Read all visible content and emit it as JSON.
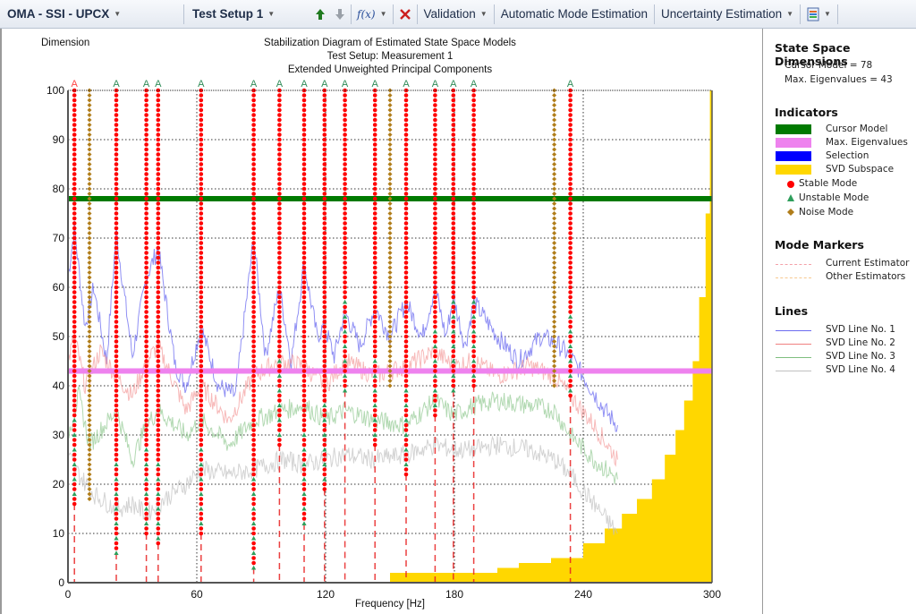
{
  "toolbar": {
    "analysis_label": "OMA - SSI - UPCX",
    "setup_label": "Test Setup 1",
    "up_arrow_icon": "green-up-arrow",
    "down_arrow_icon": "gray-down-arrow",
    "function_icon": "f(x)",
    "delete_icon": "red-x",
    "validation_label": "Validation",
    "auto_mode_label": "Automatic Mode Estimation",
    "uncertainty_label": "Uncertainty Estimation",
    "display_icon": "display-options"
  },
  "side_panel": {
    "dimensions_title": "State Space Dimensions",
    "cursor_model_text": "Cursor Model = 78",
    "max_eigen_text": "Max. Eigenvalues = 43",
    "indicators_title": "Indicators",
    "indicators": [
      {
        "label": "Cursor Model",
        "color": "#007a00",
        "kind": "bar"
      },
      {
        "label": "Max. Eigenvalues",
        "color": "#ee82ee",
        "kind": "bar"
      },
      {
        "label": "Selection",
        "color": "#0000ff",
        "kind": "bar"
      },
      {
        "label": "SVD Subspace",
        "color": "#ffd700",
        "kind": "bar"
      },
      {
        "label": "Stable Mode",
        "color": "#ff0000",
        "kind": "circle"
      },
      {
        "label": "Unstable Mode",
        "color": "#2e9e5b",
        "kind": "triangle"
      },
      {
        "label": "Noise Mode",
        "color": "#b07d1a",
        "kind": "diamond"
      }
    ],
    "markers_title": "Mode Markers",
    "markers": [
      {
        "label": "Current Estimator",
        "color": "#f4a0a8"
      },
      {
        "label": "Other Estimators",
        "color": "#f7c890"
      }
    ],
    "lines_title": "Lines",
    "lines": [
      {
        "label": "SVD Line No. 1",
        "color": "#6b6bf0"
      },
      {
        "label": "SVD Line No. 2",
        "color": "#f08080"
      },
      {
        "label": "SVD Line No. 3",
        "color": "#7fbf7f"
      },
      {
        "label": "SVD Line No. 4",
        "color": "#c0c0c0"
      }
    ]
  },
  "chart_data": {
    "type": "scatter",
    "title": "Stabilization Diagram of Estimated State Space Models",
    "subtitle_1": "Test Setup: Measurement 1",
    "subtitle_2": "Extended Unweighted Principal Components",
    "xlabel": "Frequency [Hz]",
    "ylabel": "Dimension",
    "xlim": [
      0,
      300
    ],
    "ylim": [
      0,
      100
    ],
    "xticks": [
      0,
      60,
      120,
      180,
      240,
      300
    ],
    "yticks": [
      0,
      10,
      20,
      30,
      40,
      50,
      60,
      70,
      80,
      90,
      100
    ],
    "grid": true,
    "cursor_model": 78,
    "max_eigenvalues": 43,
    "mode_columns": [
      {
        "freq": 3,
        "type": "stable",
        "min": 16,
        "marker": "A",
        "marker_color": "#ff4444"
      },
      {
        "freq": 10,
        "type": "noise",
        "min": 17,
        "marker": ""
      },
      {
        "freq": 22.5,
        "type": "stable",
        "min": 6,
        "marker": "A"
      },
      {
        "freq": 36.5,
        "type": "stable",
        "min": 10,
        "marker": "A"
      },
      {
        "freq": 42,
        "type": "stable",
        "min": 8,
        "marker": "A"
      },
      {
        "freq": 62,
        "type": "stable",
        "min": 10,
        "marker": "A"
      },
      {
        "freq": 86.5,
        "type": "stable",
        "min": 3,
        "marker": "A"
      },
      {
        "freq": 98.5,
        "type": "stable",
        "min": 28,
        "marker": "A"
      },
      {
        "freq": 110,
        "type": "stable",
        "min": 12,
        "marker": "A"
      },
      {
        "freq": 119.5,
        "type": "stable",
        "min": 19,
        "marker": "A"
      },
      {
        "freq": 129,
        "type": "stable",
        "min": 39,
        "marker": "A"
      },
      {
        "freq": 143,
        "type": "stable",
        "min": 28,
        "marker": "A"
      },
      {
        "freq": 150,
        "type": "noise",
        "min": 40,
        "marker": ""
      },
      {
        "freq": 157.5,
        "type": "stable",
        "min": 22,
        "marker": "A"
      },
      {
        "freq": 171,
        "type": "stable",
        "min": 34,
        "marker": "A"
      },
      {
        "freq": 179.5,
        "type": "stable",
        "min": 39,
        "marker": "A"
      },
      {
        "freq": 189,
        "type": "stable",
        "min": 40,
        "marker": "A"
      },
      {
        "freq": 226.5,
        "type": "noise",
        "min": 40,
        "marker": ""
      },
      {
        "freq": 234,
        "type": "stable",
        "min": 38,
        "marker": "A"
      }
    ],
    "svd_subspace_steps": [
      {
        "from": 150,
        "to": 200,
        "value": 2
      },
      {
        "from": 200,
        "to": 210,
        "value": 3
      },
      {
        "from": 210,
        "to": 225,
        "value": 4
      },
      {
        "from": 225,
        "to": 240,
        "value": 5
      },
      {
        "from": 240,
        "to": 250,
        "value": 8
      },
      {
        "from": 250,
        "to": 258,
        "value": 11
      },
      {
        "from": 258,
        "to": 265,
        "value": 14
      },
      {
        "from": 265,
        "to": 272,
        "value": 17
      },
      {
        "from": 272,
        "to": 278,
        "value": 21
      },
      {
        "from": 278,
        "to": 283,
        "value": 26
      },
      {
        "from": 283,
        "to": 287,
        "value": 31
      },
      {
        "from": 287,
        "to": 291,
        "value": 37
      },
      {
        "from": 291,
        "to": 294,
        "value": 45
      },
      {
        "from": 294,
        "to": 297,
        "value": 58
      },
      {
        "from": 297,
        "to": 299,
        "value": 75
      },
      {
        "from": 299,
        "to": 300,
        "value": 100
      }
    ],
    "svd_lines": [
      {
        "name": "SVD Line No. 1",
        "peaks": [
          [
            0,
            62
          ],
          [
            3,
            72
          ],
          [
            8,
            52
          ],
          [
            12,
            60
          ],
          [
            18,
            45
          ],
          [
            22.5,
            71
          ],
          [
            30,
            46
          ],
          [
            36.5,
            62
          ],
          [
            42,
            68
          ],
          [
            50,
            44
          ],
          [
            55,
            40
          ],
          [
            62,
            52
          ],
          [
            70,
            40
          ],
          [
            78,
            38
          ],
          [
            86.5,
            70
          ],
          [
            92,
            46
          ],
          [
            98.5,
            60
          ],
          [
            104,
            45
          ],
          [
            110,
            65
          ],
          [
            116,
            50
          ],
          [
            119.5,
            52
          ],
          [
            124,
            46
          ],
          [
            129,
            55
          ],
          [
            136,
            48
          ],
          [
            143,
            56
          ],
          [
            150,
            50
          ],
          [
            157.5,
            57
          ],
          [
            165,
            50
          ],
          [
            171,
            60
          ],
          [
            176,
            50
          ],
          [
            179.5,
            58
          ],
          [
            185,
            48
          ],
          [
            189,
            57
          ],
          [
            200,
            50
          ],
          [
            210,
            45
          ],
          [
            220,
            50
          ],
          [
            226.5,
            49
          ],
          [
            234,
            46
          ],
          [
            240,
            42
          ],
          [
            250,
            35
          ],
          [
            256,
            32
          ]
        ]
      },
      {
        "name": "SVD Line No. 2",
        "peaks": [
          [
            0,
            45
          ],
          [
            3,
            50
          ],
          [
            8,
            40
          ],
          [
            15,
            47
          ],
          [
            22.5,
            42
          ],
          [
            30,
            38
          ],
          [
            36.5,
            45
          ],
          [
            42,
            48
          ],
          [
            55,
            35
          ],
          [
            62,
            40
          ],
          [
            75,
            33
          ],
          [
            86.5,
            42
          ],
          [
            98.5,
            45
          ],
          [
            110,
            44
          ],
          [
            120,
            40
          ],
          [
            129,
            45
          ],
          [
            143,
            42
          ],
          [
            157.5,
            44
          ],
          [
            171,
            47
          ],
          [
            179.5,
            44
          ],
          [
            189,
            45
          ],
          [
            200,
            42
          ],
          [
            215,
            44
          ],
          [
            226.5,
            42
          ],
          [
            234,
            38
          ],
          [
            245,
            32
          ],
          [
            256,
            25
          ]
        ]
      },
      {
        "name": "SVD Line No. 3",
        "peaks": [
          [
            0,
            30
          ],
          [
            5,
            38
          ],
          [
            10,
            28
          ],
          [
            22.5,
            35
          ],
          [
            30,
            25
          ],
          [
            36.5,
            32
          ],
          [
            42,
            35
          ],
          [
            55,
            30
          ],
          [
            62,
            33
          ],
          [
            75,
            28
          ],
          [
            86.5,
            33
          ],
          [
            100,
            35
          ],
          [
            110,
            36
          ],
          [
            120,
            33
          ],
          [
            129,
            35
          ],
          [
            143,
            33
          ],
          [
            157.5,
            32
          ],
          [
            171,
            37
          ],
          [
            179.5,
            34
          ],
          [
            189,
            36
          ],
          [
            200,
            37
          ],
          [
            215,
            36
          ],
          [
            226.5,
            35
          ],
          [
            234,
            30
          ],
          [
            245,
            25
          ],
          [
            256,
            21
          ]
        ]
      },
      {
        "name": "SVD Line No. 4",
        "peaks": [
          [
            0,
            26
          ],
          [
            5,
            22
          ],
          [
            12,
            18
          ],
          [
            22.5,
            15
          ],
          [
            30,
            16
          ],
          [
            36.5,
            14
          ],
          [
            45,
            17
          ],
          [
            55,
            20
          ],
          [
            62,
            23
          ],
          [
            75,
            22
          ],
          [
            86.5,
            23
          ],
          [
            100,
            25
          ],
          [
            110,
            24
          ],
          [
            120,
            25
          ],
          [
            129,
            26
          ],
          [
            143,
            25
          ],
          [
            157.5,
            26
          ],
          [
            171,
            28
          ],
          [
            179.5,
            27
          ],
          [
            189,
            27
          ],
          [
            200,
            28
          ],
          [
            215,
            27
          ],
          [
            226.5,
            25
          ],
          [
            234,
            22
          ],
          [
            245,
            16
          ],
          [
            256,
            10
          ]
        ]
      }
    ]
  }
}
